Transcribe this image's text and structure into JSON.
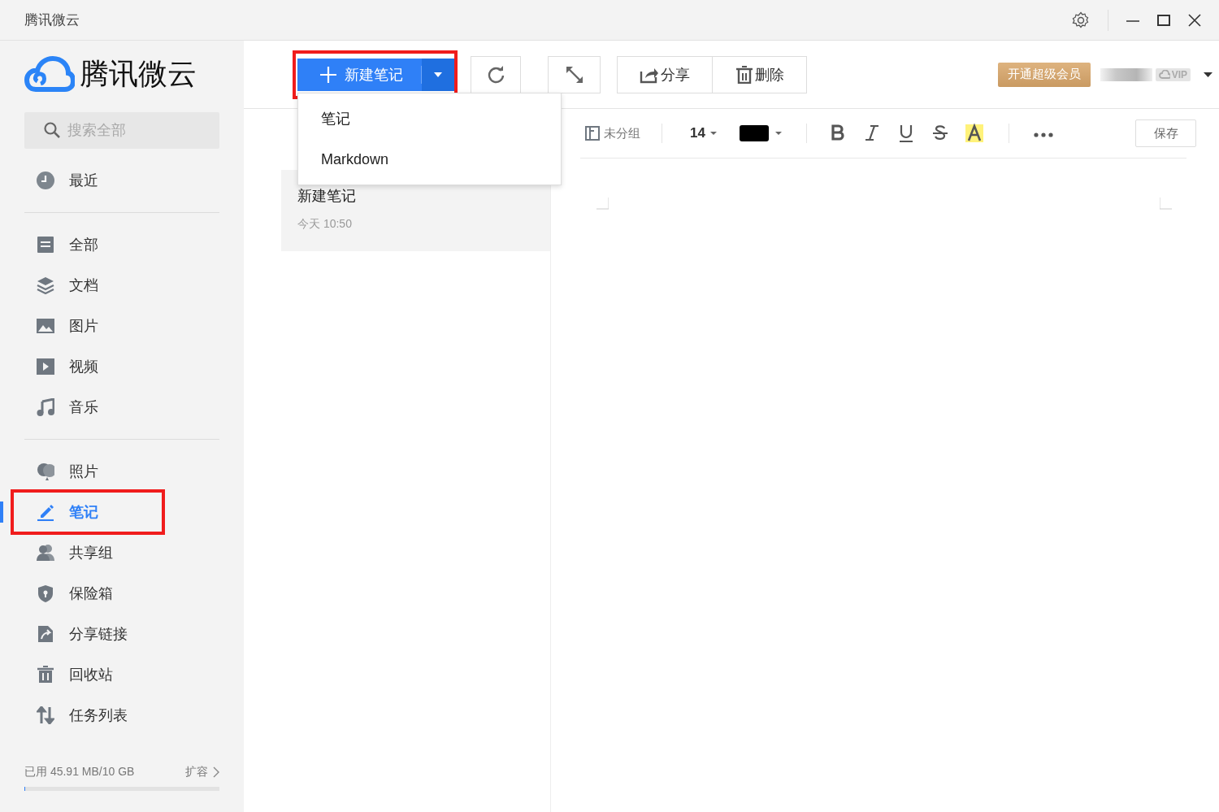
{
  "title_bar": {
    "title": "腾讯微云"
  },
  "sidebar": {
    "logo_text": "腾讯微云",
    "search": {
      "placeholder": "搜索全部"
    },
    "groups": [
      [
        {
          "label": "最近",
          "selected": false,
          "highlighted": false
        }
      ],
      [
        {
          "label": "全部",
          "selected": false,
          "highlighted": false
        },
        {
          "label": "文档",
          "selected": false,
          "highlighted": false
        },
        {
          "label": "图片",
          "selected": false,
          "highlighted": false
        },
        {
          "label": "视频",
          "selected": false,
          "highlighted": false
        },
        {
          "label": "音乐",
          "selected": false,
          "highlighted": false
        }
      ],
      [
        {
          "label": "照片",
          "selected": false,
          "highlighted": false
        },
        {
          "label": "笔记",
          "selected": true,
          "highlighted": true
        },
        {
          "label": "共享组",
          "selected": false,
          "highlighted": false
        },
        {
          "label": "保险箱",
          "selected": false,
          "highlighted": false
        },
        {
          "label": "分享链接",
          "selected": false,
          "highlighted": false
        },
        {
          "label": "回收站",
          "selected": false,
          "highlighted": false
        },
        {
          "label": "任务列表",
          "selected": false,
          "highlighted": false
        }
      ]
    ],
    "storage": {
      "text": "已用 45.91 MB/10 GB",
      "expand_link": "扩容",
      "level": 0.005
    }
  },
  "toolbar": {
    "new_button": {
      "label": "新建笔记",
      "highlighted": true,
      "menu_open": true
    },
    "menu": [
      "笔记",
      "Markdown"
    ],
    "share": "分享",
    "delete": "删除",
    "vip_button": "开通超级会员",
    "vip_badge": "VIP"
  },
  "note_list": [
    {
      "title": "新建笔记",
      "time": "今天 10:50",
      "selected": true
    }
  ],
  "editor_toolbar": {
    "folder": "未分组",
    "font_size": "14",
    "color": "#000000",
    "save": "保存"
  }
}
